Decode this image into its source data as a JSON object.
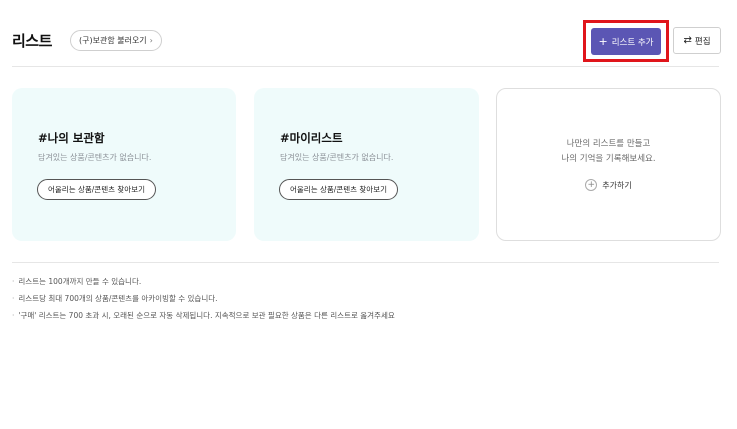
{
  "header": {
    "title": "리스트",
    "legacy_link": "(구)보관함 불러오기",
    "legacy_chevron": "›",
    "add_button": "리스트 추가",
    "add_icon": "+",
    "edit_button": "편집",
    "edit_icon": "⇄"
  },
  "cards": [
    {
      "title": "#나의 보관함",
      "subtitle": "담겨있는 상품/콘텐츠가 없습니다.",
      "button": "어울리는 상품/콘텐츠 찾아보기"
    },
    {
      "title": "#마이리스트",
      "subtitle": "담겨있는 상품/콘텐츠가 없습니다.",
      "button": "어울리는 상품/콘텐츠 찾아보기"
    }
  ],
  "new_list_card": {
    "line1": "나만의 리스트를 만들고",
    "line2": "나의 기억을 기록해보세요.",
    "add_label": "추가하기",
    "add_icon": "+"
  },
  "notes": [
    "리스트는 100개까지 만들 수 있습니다.",
    "리스트당 최대 700개의 상품/콘텐츠를 아카이빙할 수 있습니다.",
    "'구매' 리스트는 700 초과 시, 오래된 순으로 자동 삭제됩니다. 지속적으로 보관 필요한 상품은 다른 리스트로 옮겨주세요"
  ],
  "note_bullet": "·",
  "colors": {
    "accent": "#5b56b4",
    "highlight_box": "#e0151b",
    "card_mint": "#effbfb"
  }
}
